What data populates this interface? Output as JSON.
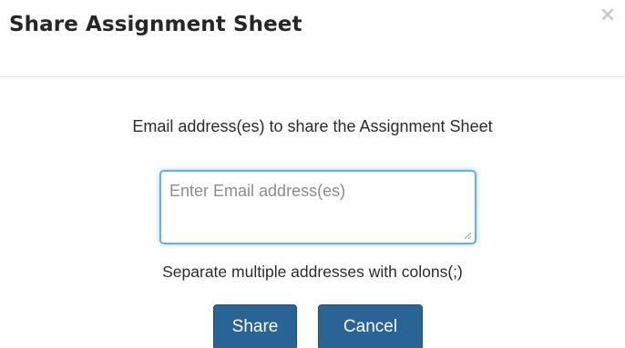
{
  "dialog": {
    "title": "Share Assignment Sheet",
    "close_symbol": "×",
    "close_icon": "close-icon"
  },
  "form": {
    "instructions": "Email address(es) to share the Assignment Sheet",
    "email_placeholder": "Enter Email address(es)",
    "email_value": "",
    "hint": "Separate multiple addresses with colons(;)"
  },
  "buttons": {
    "share_label": "Share",
    "cancel_label": "Cancel"
  },
  "colors": {
    "primary_button": "#2a6496",
    "focus_border": "#66afe9",
    "close_icon": "#c8c8c8"
  }
}
